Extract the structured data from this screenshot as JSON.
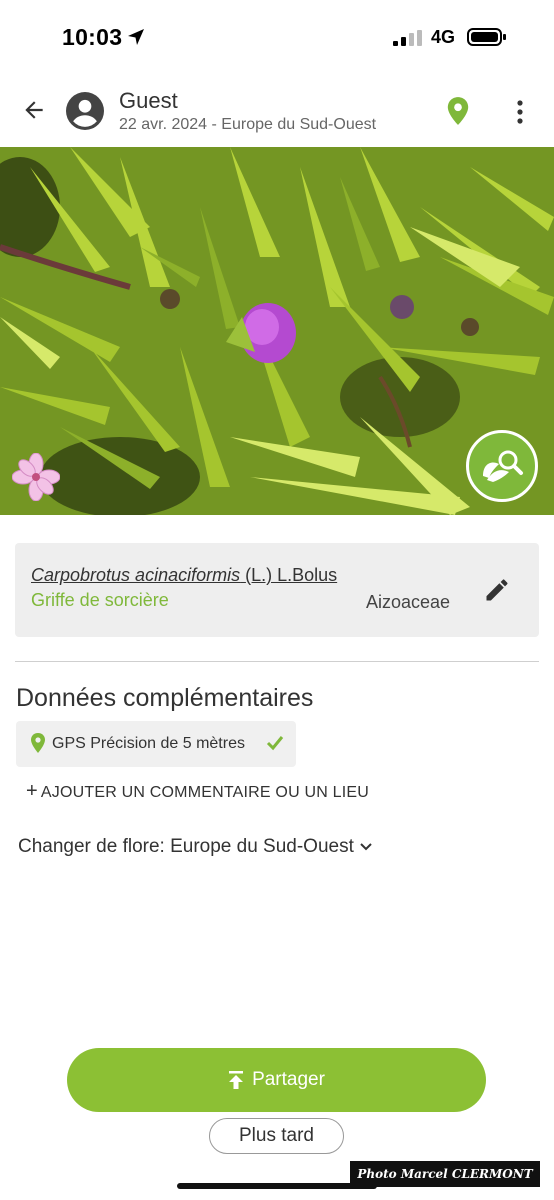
{
  "status_bar": {
    "time": "10:03",
    "network": "4G"
  },
  "header": {
    "user_name": "Guest",
    "subtitle": "22 avr. 2024 - Europe du Sud-Ouest"
  },
  "icons": {
    "back": "arrow-left-icon",
    "avatar": "account-circle-icon",
    "map": "map-pin-icon",
    "more": "more-vertical-icon",
    "identify": "leaf-search-icon",
    "flower": "flower-icon",
    "edit": "pencil-icon",
    "gps": "map-pin-icon",
    "check": "check-icon",
    "share": "upload-icon"
  },
  "species": {
    "scientific_name": "Carpobrotus acinaciformis",
    "author": "(L.) L.Bolus",
    "common_name": "Griffe de sorcière",
    "family": "Aizoaceae"
  },
  "extra": {
    "title": "Données complémentaires",
    "gps": "GPS Précision de 5 mètres",
    "add_comment": "AJOUTER UN COMMENTAIRE OU UN LIEU",
    "flora_label": "Changer de flore: Europe du Sud-Ouest"
  },
  "actions": {
    "share": "Partager",
    "later": "Plus tard"
  },
  "watermark": "Photo Marcel CLERMONT",
  "colors": {
    "accent": "#8cc034",
    "accent_text": "#7fb83a",
    "card_bg": "#eeeeee"
  }
}
